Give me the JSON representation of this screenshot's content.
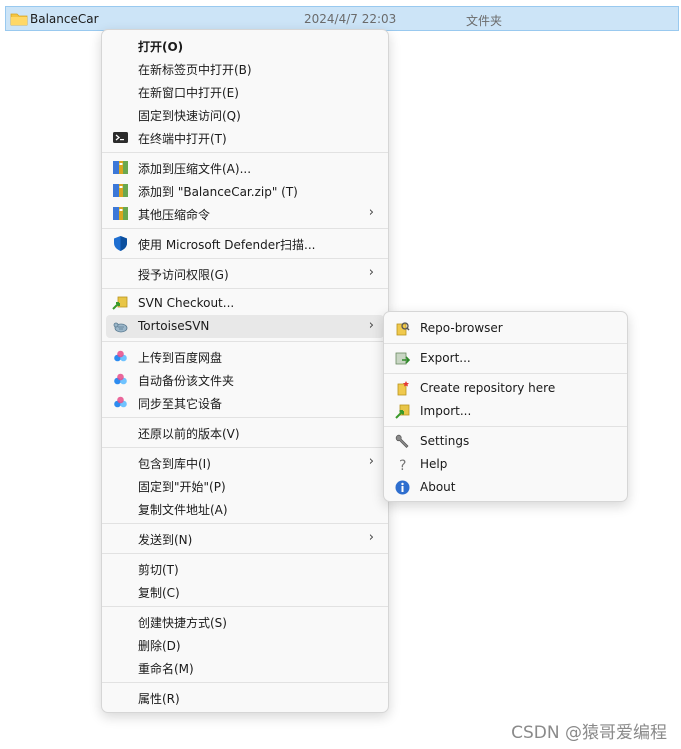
{
  "file": {
    "name": "BalanceCar",
    "date": "2024/4/7 22:03",
    "type": "文件夹"
  },
  "menu": {
    "items": [
      {
        "label": "打开(O)"
      },
      {
        "label": "在新标签页中打开(B)"
      },
      {
        "label": "在新窗口中打开(E)"
      },
      {
        "label": "固定到快速访问(Q)"
      },
      {
        "label": "在终端中打开(T)"
      },
      {
        "label": "添加到压缩文件(A)..."
      },
      {
        "label": "添加到 \"BalanceCar.zip\" (T)"
      },
      {
        "label": "其他压缩命令"
      },
      {
        "label": "使用 Microsoft Defender扫描..."
      },
      {
        "label": "授予访问权限(G)"
      },
      {
        "label": "SVN Checkout..."
      },
      {
        "label": "TortoiseSVN"
      },
      {
        "label": "上传到百度网盘"
      },
      {
        "label": "自动备份该文件夹"
      },
      {
        "label": "同步至其它设备"
      },
      {
        "label": "还原以前的版本(V)"
      },
      {
        "label": "包含到库中(I)"
      },
      {
        "label": "固定到\"开始\"(P)"
      },
      {
        "label": "复制文件地址(A)"
      },
      {
        "label": "发送到(N)"
      },
      {
        "label": "剪切(T)"
      },
      {
        "label": "复制(C)"
      },
      {
        "label": "创建快捷方式(S)"
      },
      {
        "label": "删除(D)"
      },
      {
        "label": "重命名(M)"
      },
      {
        "label": "属性(R)"
      }
    ]
  },
  "submenu": {
    "items": [
      {
        "label": "Repo-browser"
      },
      {
        "label": "Export..."
      },
      {
        "label": "Create repository here"
      },
      {
        "label": "Import..."
      },
      {
        "label": "Settings"
      },
      {
        "label": "Help"
      },
      {
        "label": "About"
      }
    ]
  },
  "watermark": "CSDN @猿哥爱编程",
  "colors": {
    "selection": "#cce4f7",
    "menu_bg": "#f9f9f9",
    "hover": "#e8e8e8",
    "accent_blue": "#0067c0"
  }
}
